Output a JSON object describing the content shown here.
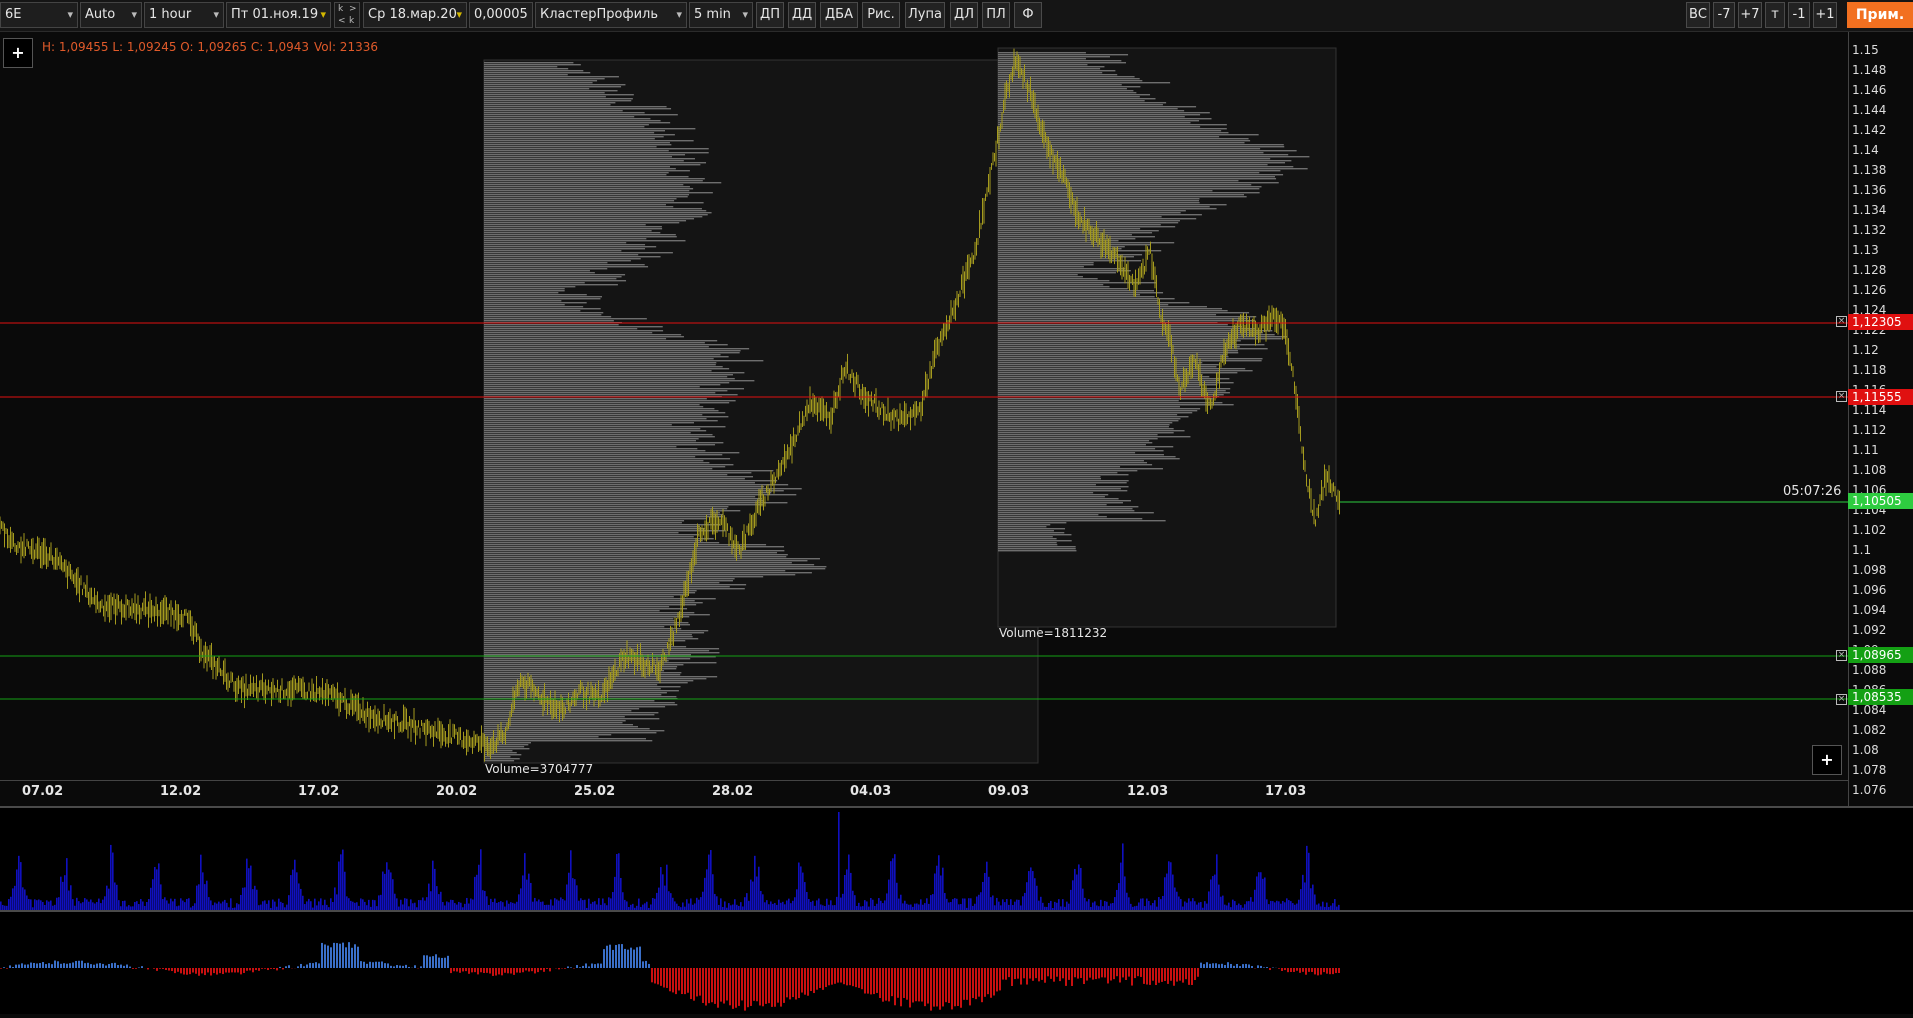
{
  "toolbar": {
    "symbol": "6E",
    "scale": "Auto",
    "timeframe": "1 hour",
    "date_from": "Пт 01.ноя.19",
    "k_up": "k",
    "k_up_arrow": ">",
    "k_down_arrow": "<",
    "k_down": "k",
    "date_to": "Ср 18.мар.20",
    "tick_size": "0,00005",
    "chart_type": "КластерПрофиль",
    "cluster_period": "5 min",
    "btn_dp": "ДП",
    "btn_dd": "ДД",
    "btn_dba": "ДБА",
    "btn_draw": "Рис.",
    "btn_magnifier": "Лупа",
    "btn_dl": "ДЛ",
    "btn_pl": "ПЛ",
    "btn_f": "Ф",
    "btn_bc": "ВС",
    "btn_minus7": "-7",
    "btn_plus7": "+7",
    "btn_t": "т",
    "btn_minus1": "-1",
    "btn_plus1": "+1",
    "btn_apply": "Прим."
  },
  "info": {
    "ohlc": "H: 1,09455 L: 1,09245 O: 1,09265 C: 1,0943",
    "volume": "Vol: 21336",
    "plus": "+"
  },
  "price_axis": {
    "ticks": [
      "1.15",
      "1.148",
      "1.146",
      "1.144",
      "1.142",
      "1.14",
      "1.138",
      "1.136",
      "1.134",
      "1.132",
      "1.13",
      "1.128",
      "1.126",
      "1.124",
      "1.122",
      "1.12",
      "1.118",
      "1.116",
      "1.114",
      "1.112",
      "1.11",
      "1.108",
      "1.106",
      "1.104",
      "1.102",
      "1.1",
      "1.098",
      "1.096",
      "1.094",
      "1.092",
      "1.09",
      "1.088",
      "1.086",
      "1.084",
      "1.082",
      "1.08",
      "1.078",
      "1.076"
    ]
  },
  "time_axis": {
    "ticks": [
      "07.02",
      "12.02",
      "17.02",
      "20.02",
      "25.02",
      "28.02",
      "04.03",
      "09.03",
      "12.03",
      "17.03"
    ]
  },
  "levels": [
    {
      "price": "1,12305",
      "color": "#e01010"
    },
    {
      "price": "1,11555",
      "color": "#e01010"
    },
    {
      "price": "1,08965",
      "color": "#14a014"
    },
    {
      "price": "1,08535",
      "color": "#14a014"
    }
  ],
  "last_price": {
    "value": "1,10505",
    "color": "#2ecc40",
    "timer": "05:07:26"
  },
  "profiles": [
    {
      "label": "Volume=3704777"
    },
    {
      "label": "Volume=1811232"
    }
  ],
  "colors": {
    "candles": "#a49a1e",
    "profile": "#6e6e6e",
    "volume_bars": "#1010c0",
    "delta_pos": "#3a6fc8",
    "delta_neg": "#c81010"
  }
}
